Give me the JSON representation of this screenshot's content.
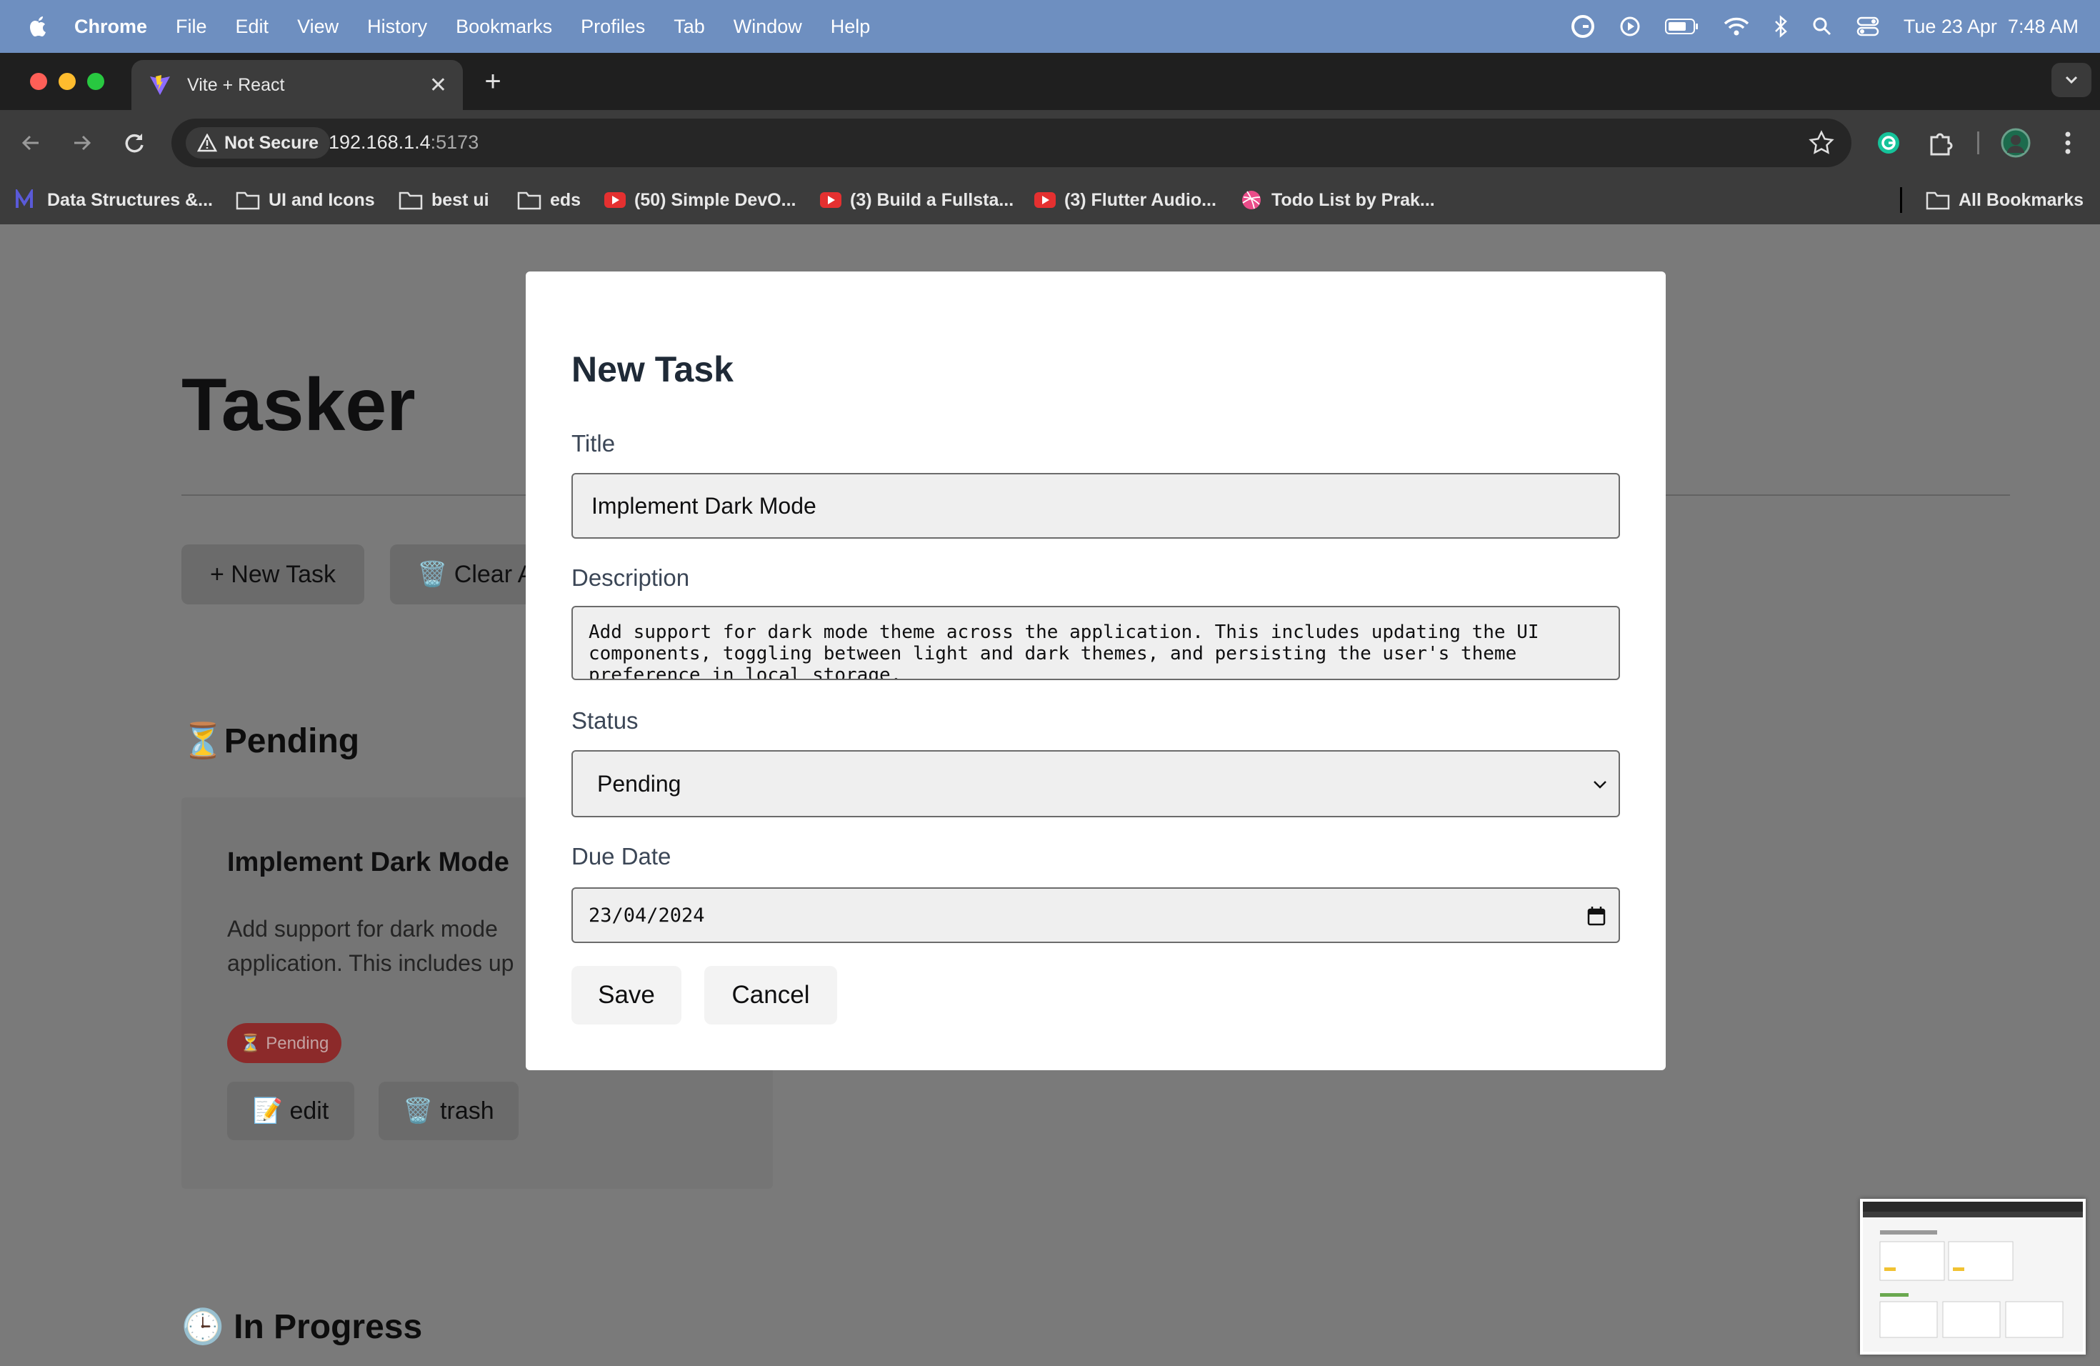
{
  "menubar": {
    "app": "Chrome",
    "items": [
      "File",
      "Edit",
      "View",
      "History",
      "Bookmarks",
      "Profiles",
      "Tab",
      "Window",
      "Help"
    ],
    "datetime": "Tue 23 Apr  7:48 AM"
  },
  "browser": {
    "tab_title": "Vite + React",
    "security_label": "Not Secure",
    "url_host": "192.168.1.4",
    "url_port": ":5173",
    "bookmarks": [
      "Data Structures &...",
      "UI and Icons",
      "best ui",
      "eds",
      "(50) Simple DevO...",
      "(3) Build a Fullsta...",
      "(3) Flutter Audio...",
      "Todo List by Prak..."
    ],
    "all_bookmarks": "All Bookmarks"
  },
  "page": {
    "title": "Tasker",
    "new_task_button": "+ New Task",
    "clear_button": "🗑️ Clear A",
    "pending_heading": "⏳Pending",
    "in_progress_heading": "🕒 In Progress",
    "card": {
      "title": "Implement Dark Mode",
      "description_line1": "Add support for dark mode",
      "description_line2": "application. This includes up",
      "badge": "⏳ Pending",
      "edit": "📝 edit",
      "trash": "🗑️ trash"
    }
  },
  "modal": {
    "heading": "New Task",
    "title_label": "Title",
    "title_value": "Implement Dark Mode",
    "description_label": "Description",
    "description_value": "Add support for dark mode theme across the application. This includes updating the UI\ncomponents, toggling between light and dark themes, and persisting the user's theme\npreference in local storage.",
    "status_label": "Status",
    "status_value": "Pending",
    "due_label": "Due Date",
    "due_value": "23/04/2024",
    "save": "Save",
    "cancel": "Cancel"
  }
}
